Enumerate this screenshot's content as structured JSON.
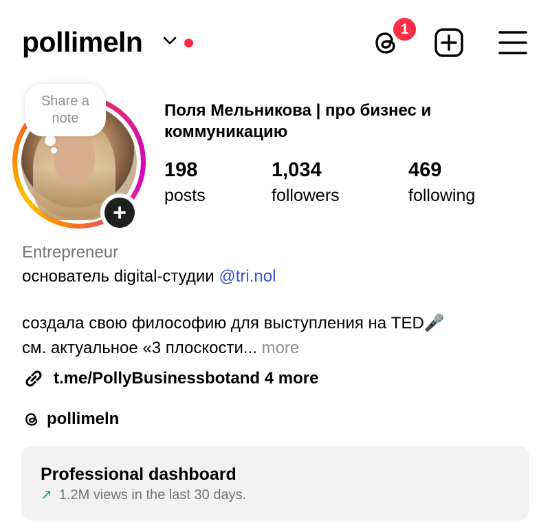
{
  "header": {
    "username": "pollimeln",
    "threads_badge_count": "1",
    "icons": [
      "chevron-down-icon",
      "threads-icon",
      "add-post-icon",
      "menu-icon"
    ],
    "notification_dot_color": "#ff2d46"
  },
  "avatar": {
    "note_text": "Share a note",
    "story_ring": true
  },
  "profile": {
    "full_name": "Поля Мельникова | про бизнес и коммуникацию",
    "stats": [
      {
        "value": "198",
        "label": "posts"
      },
      {
        "value": "1,034",
        "label": "followers"
      },
      {
        "value": "469",
        "label": "following"
      }
    ]
  },
  "bio": {
    "category": "Entrepreneur",
    "line1_text": "основатель digital-студии ",
    "line1_mention": "@tri.nol",
    "line2": "создала свою философию для выступления на TED🎤",
    "line3_text": "см. актуальное «3 плоскости...",
    "line3_more": "more",
    "link_main": "t.me/PollyBusinessbot",
    "link_suffix": " and 4 more",
    "threads_handle": "pollimeln"
  },
  "dashboard": {
    "title": "Professional dashboard",
    "subtitle": "1.2M views in the last 30 days.",
    "accent_color": "#1f9d55"
  }
}
